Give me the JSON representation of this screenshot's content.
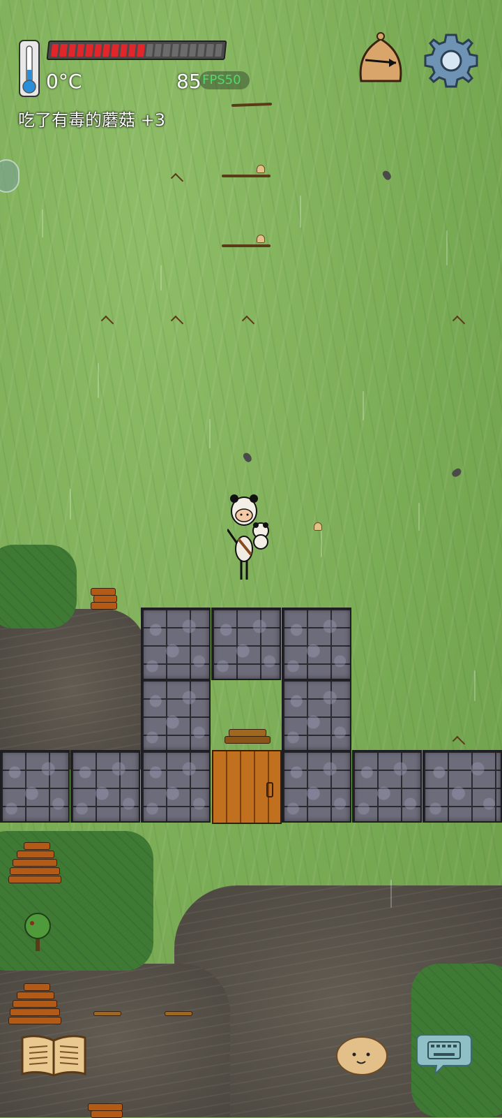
{
  "hud": {
    "temperature": "0°C",
    "health_value": "85",
    "health_fraction": 0.55,
    "health_segments_total": 20,
    "health_segments_filled": 11,
    "fps_label": "FPS50",
    "message": "吃了有毒的蘑菇 +3"
  },
  "colors": {
    "health_fill": "#e0262a",
    "health_empty": "#6b6b6b",
    "fps_text": "#54d86a",
    "grass": "#7fae5a",
    "dirt": "#555048",
    "stone": "#6d6c7a",
    "door": "#c0701e"
  },
  "icons": {
    "thermometer": "thermometer-icon",
    "clock": "compass-clock-icon",
    "settings": "gear-icon",
    "journal": "open-book-icon",
    "companion": "potato-face-icon",
    "chat": "keyboard-bubble-icon"
  }
}
